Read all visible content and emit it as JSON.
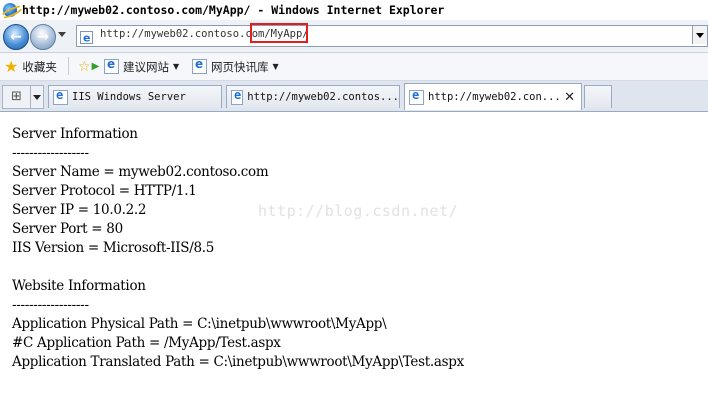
{
  "window": {
    "title": "http://myweb02.contoso.com/MyApp/ - Windows Internet Explorer"
  },
  "address_bar": {
    "url": "http://myweb02.contoso.com/MyApp/"
  },
  "favorites_bar": {
    "favorites_label": "收藏夹",
    "suggested_sites_label": "建议网站",
    "web_slice_gallery_label": "网页快讯库"
  },
  "tabs": [
    {
      "label": "IIS Windows Server"
    },
    {
      "label": "http://myweb02.contos..."
    },
    {
      "label": "http://myweb02.con...",
      "active": true
    }
  ],
  "page": {
    "lines": [
      "Server Information",
      "------------------",
      "Server Name = myweb02.contoso.com",
      "Server Protocol = HTTP/1.1",
      "Server IP = 10.0.2.2",
      "Server Port = 80",
      "IIS Version = Microsoft-IIS/8.5",
      "",
      "Website Information",
      "------------------",
      "Application Physical Path = C:\\inetpub\\wwwroot\\MyApp\\",
      "#C Application Path = /MyApp/Test.aspx",
      "Application Translated Path = C:\\inetpub\\wwwroot\\MyApp\\Test.aspx"
    ],
    "watermark": "http://blog.csdn.net/"
  }
}
